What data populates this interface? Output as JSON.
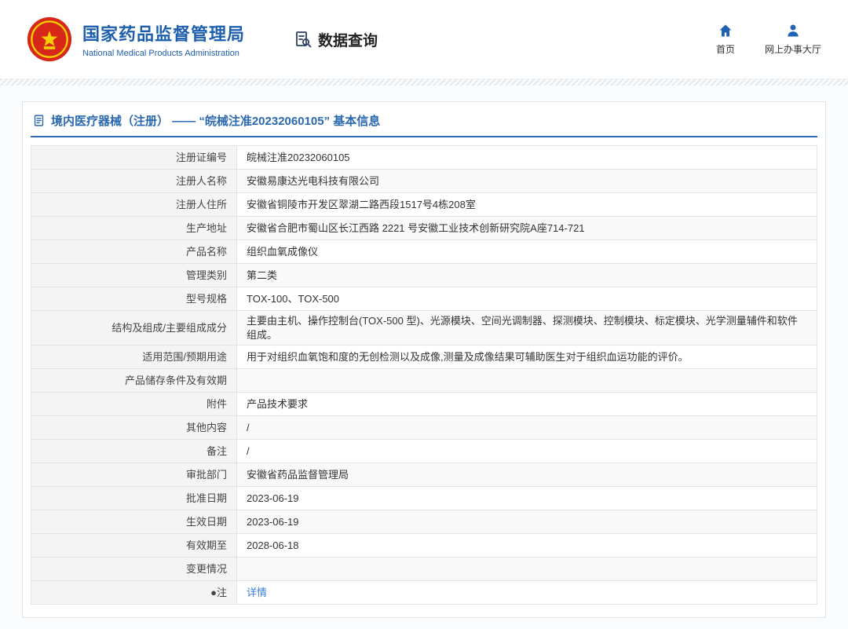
{
  "colors": {
    "brand_blue": "#1d5fae",
    "panel_blue": "#2a68b0",
    "link_blue": "#3a7fd5",
    "emblem_red": "#d62718",
    "emblem_gold": "#f8d000"
  },
  "header": {
    "org_name_cn": "国家药品监督管理局",
    "org_name_en": "National Medical Products Administration",
    "section_title": "数据查询",
    "nav": [
      {
        "label": "首页",
        "icon": "home-icon"
      },
      {
        "label": "网上办事大厅",
        "icon": "user-icon"
      }
    ]
  },
  "page": {
    "title": "境内医疗器械（注册） —— “皖械注准20232060105” 基本信息"
  },
  "table": {
    "rows": [
      {
        "label": "注册证编号",
        "value": "皖械注准20232060105"
      },
      {
        "label": "注册人名称",
        "value": "安徽易康达光电科技有限公司"
      },
      {
        "label": "注册人住所",
        "value": "安徽省铜陵市开发区翠湖二路西段1517号4栋208室"
      },
      {
        "label": "生产地址",
        "value": "安徽省合肥市蜀山区长江西路 2221 号安徽工业技术创新研究院A座714-721"
      },
      {
        "label": "产品名称",
        "value": "组织血氧成像仪"
      },
      {
        "label": "管理类别",
        "value": "第二类"
      },
      {
        "label": "型号规格",
        "value": "TOX-100、TOX-500"
      },
      {
        "label": "结构及组成/主要组成成分",
        "value": "主要由主机、操作控制台(TOX-500 型)、光源模块、空间光调制器、探测模块、控制模块、标定模块、光学测量辅件和软件组成。"
      },
      {
        "label": "适用范围/预期用途",
        "value": "用于对组织血氧饱和度的无创检测以及成像,测量及成像结果可辅助医生对于组织血运功能的评价。"
      },
      {
        "label": "产品储存条件及有效期",
        "value": ""
      },
      {
        "label": "附件",
        "value": "产品技术要求"
      },
      {
        "label": "其他内容",
        "value": "/"
      },
      {
        "label": "备注",
        "value": "/"
      },
      {
        "label": "审批部门",
        "value": "安徽省药品监督管理局"
      },
      {
        "label": "批准日期",
        "value": "2023-06-19"
      },
      {
        "label": "生效日期",
        "value": "2023-06-19"
      },
      {
        "label": "有效期至",
        "value": "2028-06-18"
      },
      {
        "label": "变更情况",
        "value": ""
      },
      {
        "label": "●注",
        "value": "详情",
        "link": true
      }
    ]
  }
}
